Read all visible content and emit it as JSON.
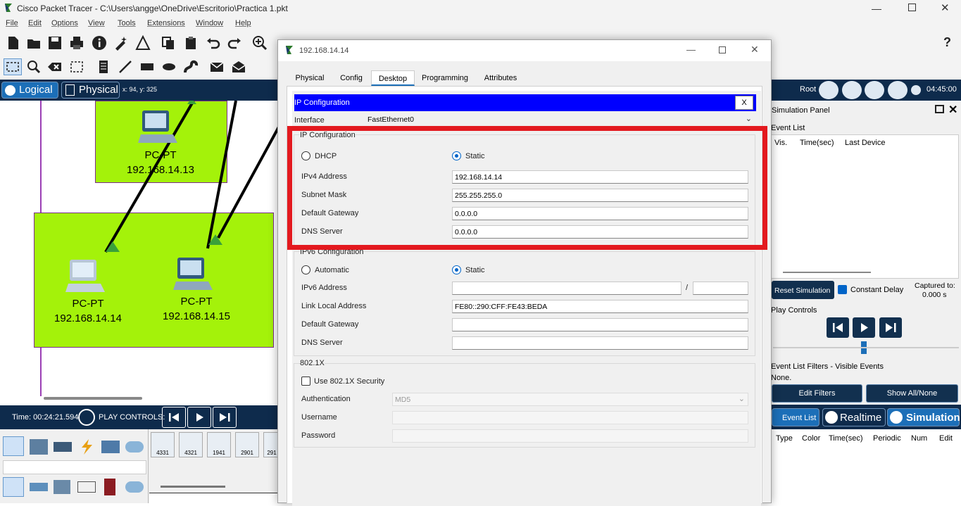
{
  "window": {
    "title": "Cisco Packet Tracer - C:\\Users\\angge\\OneDrive\\Escritorio\\Practica 1.pkt"
  },
  "menu": [
    "File",
    "Edit",
    "Options",
    "View",
    "Tools",
    "Extensions",
    "Window",
    "Help"
  ],
  "help_icon_label": "?",
  "modebar": {
    "logical": "Logical",
    "physical": "Physical",
    "coords": "x: 94, y: 325",
    "root": "Root",
    "clock": "04:45:00"
  },
  "workspace": {
    "devices": [
      {
        "type": "PC-PT",
        "ip": "192.168.14.13"
      },
      {
        "type": "PC-PT",
        "ip": "192.168.14.14"
      },
      {
        "type": "PC-PT",
        "ip": "192.168.14.15"
      }
    ]
  },
  "bottombar": {
    "time": "Time: 00:24:21.594",
    "play_controls": "PLAY CONTROLS:"
  },
  "device_models": [
    "4331",
    "4321",
    "1941",
    "2901",
    "291"
  ],
  "dialog": {
    "title": "192.168.14.14",
    "tabs": [
      "Physical",
      "Config",
      "Desktop",
      "Programming",
      "Attributes"
    ],
    "active_tab": "Desktop",
    "banner": "IP Configuration",
    "close_label": "X",
    "interface_label": "Interface",
    "interface_value": "FastEthernet0",
    "ipv4_group": "IP Configuration",
    "dhcp_label": "DHCP",
    "static_label": "Static",
    "ipv4_address_label": "IPv4 Address",
    "ipv4_address": "192.168.14.14",
    "subnet_mask_label": "Subnet Mask",
    "subnet_mask": "255.255.255.0",
    "gateway_label": "Default Gateway",
    "gateway": "0.0.0.0",
    "dns_label": "DNS Server",
    "dns": "0.0.0.0",
    "ipv6_group": "IPv6 Configuration",
    "automatic_label": "Automatic",
    "static6_label": "Static",
    "ipv6_address_label": "IPv6 Address",
    "ipv6_slash": "/",
    "link_local_label": "Link Local Address",
    "link_local": "FE80::290:CFF:FE43:BEDA",
    "gateway6_label": "Default Gateway",
    "dns6_label": "DNS Server",
    "dot1x_group": "802.1X",
    "dot1x_security": "Use 802.1X Security",
    "auth_label": "Authentication",
    "auth_value": "MD5",
    "username_label": "Username",
    "password_label": "Password"
  },
  "sim": {
    "panel_title": "Simulation Panel",
    "event_list": "Event List",
    "cols": [
      "Vis.",
      "Time(sec)",
      "Last Device"
    ],
    "reset": "Reset Simulation",
    "constant_delay": "Constant Delay",
    "captured_label": "Captured to:",
    "captured_value": "0.000 s",
    "play_controls": "Play Controls",
    "filters_label": "Event List Filters - Visible Events",
    "filters_value": "None.",
    "edit_filters": "Edit Filters",
    "show_all": "Show All/None",
    "event_list_btn": "Event List",
    "realtime": "Realtime",
    "simulation": "Simulation",
    "pdu_cols": [
      "Type",
      "Color",
      "Time(sec)",
      "Periodic",
      "Num",
      "Edit"
    ]
  },
  "colors": {
    "device_area": "#a4f20a",
    "dark_bar": "#0e2b4c",
    "banner": "#0000ff",
    "highlight": "#e3191f"
  }
}
